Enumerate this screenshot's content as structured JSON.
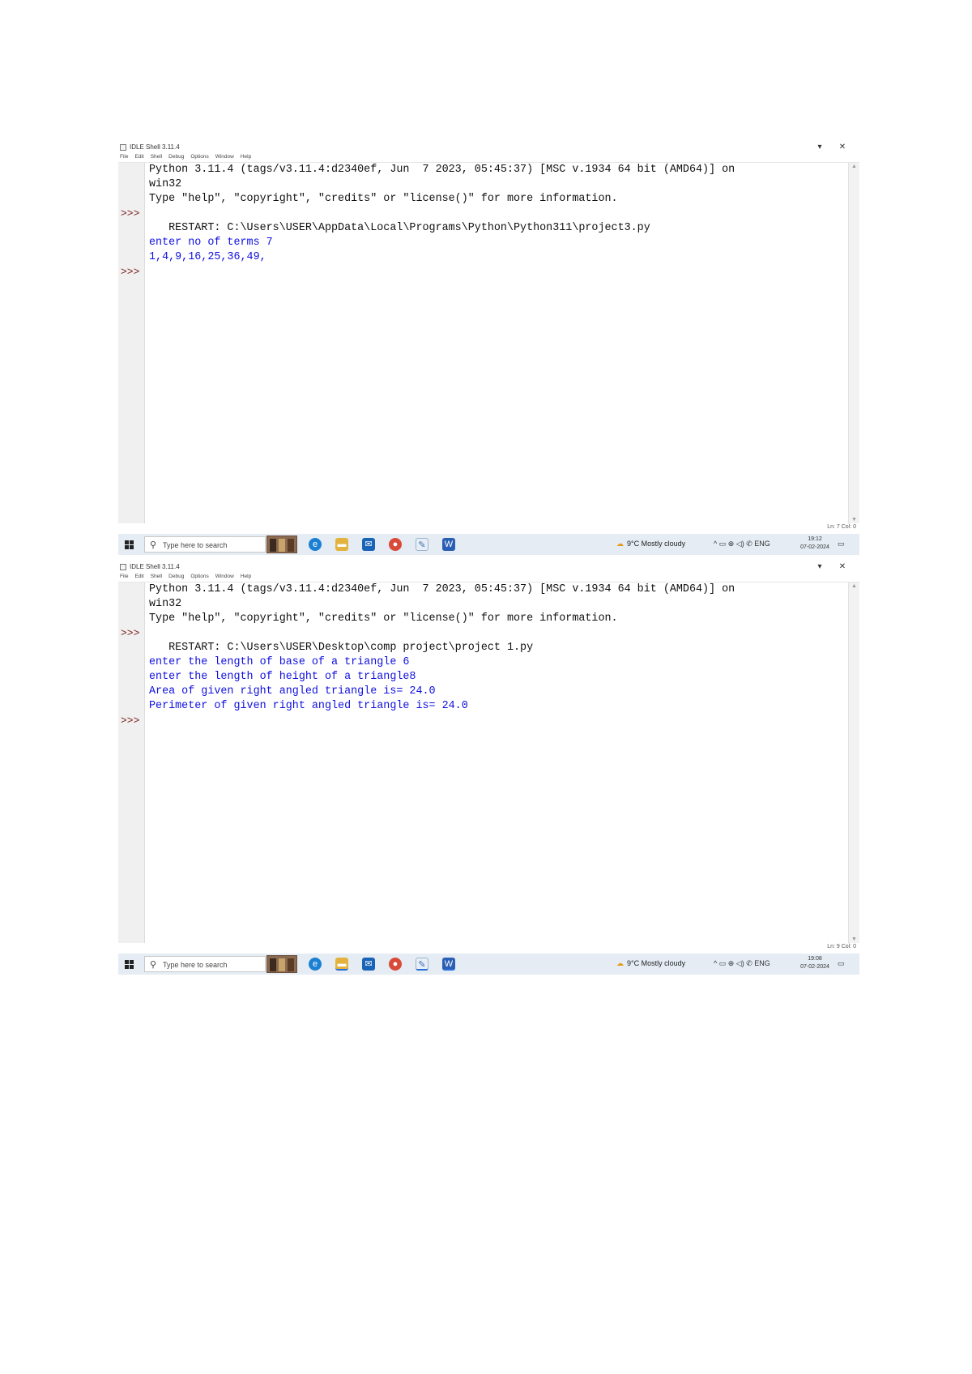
{
  "screenshots": [
    {
      "window": {
        "title": "IDLE Shell 3.11.4",
        "minimize_glyph": "▾",
        "close_glyph": "✕",
        "menu": [
          "File",
          "Edit",
          "Shell",
          "Debug",
          "Options",
          "Window",
          "Help"
        ],
        "prompt": ">>>",
        "lines": [
          "Python 3.11.4 (tags/v3.11.4:d2340ef, Jun  7 2023, 05:45:37) [MSC v.1934 64 bit (AMD64)] on",
          "win32",
          "Type \"help\", \"copyright\", \"credits\" or \"license()\" for more information.",
          "",
          "   RESTART: C:\\Users\\USER\\AppData\\Local\\Programs\\Python\\Python311\\project3.py",
          "enter no of terms 7",
          "1,4,9,16,25,36,49,",
          ""
        ],
        "status": "Ln: 7  Col: 0"
      },
      "taskbar": {
        "search_placeholder": "Type here to search",
        "weather": "9°C  Mostly cloudy",
        "tray": "^  ▭  ⊕  ◁)  ✆  ENG",
        "time": "19:12",
        "date": "07-02-2024",
        "notify_glyph": "▭"
      }
    },
    {
      "window": {
        "title": "IDLE Shell 3.11.4",
        "minimize_glyph": "▾",
        "close_glyph": "✕",
        "menu": [
          "File",
          "Edit",
          "Shell",
          "Debug",
          "Options",
          "Window",
          "Help"
        ],
        "prompt": ">>>",
        "lines": [
          "Python 3.11.4 (tags/v3.11.4:d2340ef, Jun  7 2023, 05:45:37) [MSC v.1934 64 bit (AMD64)] on",
          "win32",
          "Type \"help\", \"copyright\", \"credits\" or \"license()\" for more information.",
          "",
          "   RESTART: C:\\Users\\USER\\Desktop\\comp project\\project 1.py",
          "enter the length of base of a triangle 6",
          "enter the length of height of a triangle8",
          "Area of given right angled triangle is= 24.0",
          "Perimeter of given right angled triangle is= 24.0",
          ""
        ],
        "status": "Ln: 9  Col: 0"
      },
      "taskbar": {
        "search_placeholder": "Type here to search",
        "weather": "9°C  Mostly cloudy",
        "tray": "^  ▭  ⊕  ◁)  ✆  ENG",
        "time": "19:08",
        "date": "07-02-2024",
        "notify_glyph": "▭"
      }
    }
  ],
  "colors": {
    "output_text": "#1010e0",
    "normal_text": "#111111",
    "prompt": "#7a1f1f",
    "taskbar": "#e5ecf4"
  }
}
